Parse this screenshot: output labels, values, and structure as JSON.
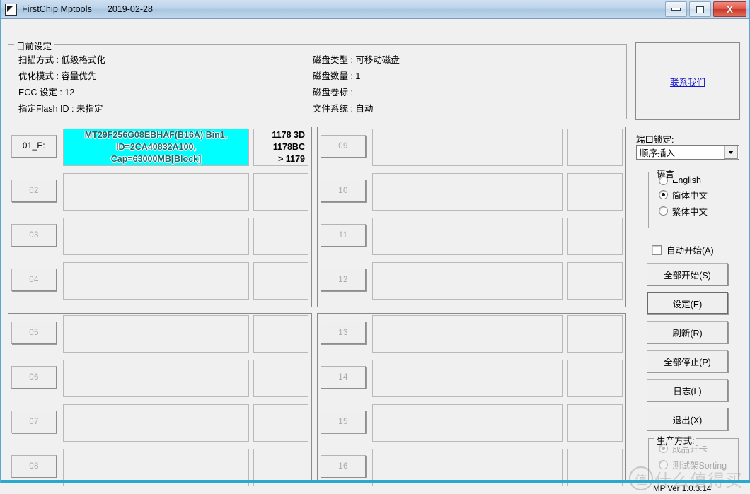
{
  "window": {
    "title": "FirstChip Mptools",
    "date": "2019-02-28",
    "icon": "app-flag-icon",
    "controls": {
      "minimize": "minimize-icon",
      "maximize": "maximize-icon",
      "close": "X"
    }
  },
  "settings": {
    "legend": "目前设定",
    "left": [
      "扫描方式 : 低级格式化",
      "优化模式 : 容量优先",
      "ECC 设定 : 12",
      "指定Flash ID : 未指定"
    ],
    "right": [
      "磁盘类型 : 可移动磁盘",
      "磁盘数量 : 1",
      "磁盘卷标 :",
      "文件系统 : 自动"
    ]
  },
  "slots": {
    "panel1": [
      {
        "label": "01_E:",
        "active": true,
        "info": "MT29F256G08EBHAF(B16A)  Bin1,\nID=2CA40832A100,\nCap=63000MB[Block]",
        "code": "1178 3D\n1178BC\n> 1179"
      },
      {
        "label": "02",
        "active": false,
        "info": "",
        "code": ""
      },
      {
        "label": "03",
        "active": false,
        "info": "",
        "code": ""
      },
      {
        "label": "04",
        "active": false,
        "info": "",
        "code": ""
      }
    ],
    "panel2": [
      {
        "label": "09",
        "active": false,
        "info": "",
        "code": ""
      },
      {
        "label": "10",
        "active": false,
        "info": "",
        "code": ""
      },
      {
        "label": "11",
        "active": false,
        "info": "",
        "code": ""
      },
      {
        "label": "12",
        "active": false,
        "info": "",
        "code": ""
      }
    ],
    "panel3": [
      {
        "label": "05",
        "active": false,
        "info": "",
        "code": ""
      },
      {
        "label": "06",
        "active": false,
        "info": "",
        "code": ""
      },
      {
        "label": "07",
        "active": false,
        "info": "",
        "code": ""
      },
      {
        "label": "08",
        "active": false,
        "info": "",
        "code": ""
      }
    ],
    "panel4": [
      {
        "label": "13",
        "active": false,
        "info": "",
        "code": ""
      },
      {
        "label": "14",
        "active": false,
        "info": "",
        "code": ""
      },
      {
        "label": "15",
        "active": false,
        "info": "",
        "code": ""
      },
      {
        "label": "16",
        "active": false,
        "info": "",
        "code": ""
      }
    ]
  },
  "sidebar": {
    "contact_link": "联系我们",
    "port_lock_label": "端口锁定:",
    "port_lock_value": "顺序插入",
    "language": {
      "legend": "语言",
      "options": [
        {
          "label": "English",
          "selected": false
        },
        {
          "label": "简体中文",
          "selected": true
        },
        {
          "label": "繁体中文",
          "selected": false
        }
      ]
    },
    "auto_start": {
      "label": "自动开始(A)",
      "checked": false
    },
    "buttons": [
      {
        "label": "全部开始(S)",
        "focused": false
      },
      {
        "label": "设定(E)",
        "focused": true
      },
      {
        "label": "刷新(R)",
        "focused": false
      },
      {
        "label": "全部停止(P)",
        "focused": false
      },
      {
        "label": "日志(L)",
        "focused": false
      },
      {
        "label": "退出(X)",
        "focused": false
      }
    ],
    "production": {
      "legend": "生产方式:",
      "options": [
        {
          "label": "成品开卡",
          "selected": true
        },
        {
          "label": "测试架Sorting",
          "selected": false
        }
      ]
    },
    "version": "MP Ver 1.0.3.14"
  },
  "watermark": {
    "mark": "值",
    "text": "什么值得买"
  },
  "colors": {
    "highlight_bg": "#00ffff",
    "highlight_text": "#16686b",
    "link": "#1313d0",
    "title_gradient_top": "#cfe0f1",
    "close_button": "#c9372a",
    "status_bar": "#29a8d0"
  }
}
